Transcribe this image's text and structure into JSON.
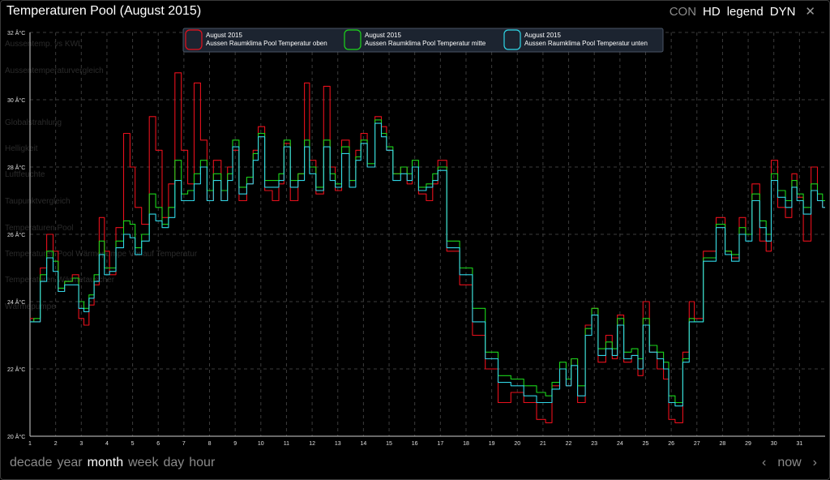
{
  "title": "Temperaturen Pool (August 2015)",
  "top_controls": {
    "con": "CON",
    "hd": "HD",
    "legend": "legend",
    "dyn": "DYN",
    "close": "✕"
  },
  "bottom_nav": {
    "decade": "decade",
    "year": "year",
    "month": "month",
    "week": "week",
    "day": "day",
    "hour": "hour",
    "prev": "‹",
    "now": "now",
    "next": "›"
  },
  "ghost_menu": [
    "Aussentemp. vs KWL",
    "Aussentemperaturvergleich",
    "Globalstrahlung",
    "Helligkeit",
    "Luftfeuchte",
    "Taupunktvergleich",
    "Temperaturen Pool",
    "Temperaturen Pool Wärmepumpe Vorlauf Temperatur",
    "Temperaturen Wärmetauscher",
    "Wärmepumpe"
  ],
  "colors": {
    "oben": "#e8101c",
    "mitte": "#1bd51b",
    "unten": "#2fd6e6",
    "grid": "#3c3c3c",
    "axis": "#cfcfcf"
  },
  "chart_data": {
    "type": "line",
    "ylim": [
      20,
      32
    ],
    "xlim": [
      1,
      32
    ],
    "y_ticks": [
      20,
      22,
      24,
      26,
      28,
      30,
      32
    ],
    "y_tick_labels": [
      "20 Â°C",
      "22 Â°C",
      "24 Â°C",
      "26 Â°C",
      "28 Â°C",
      "30 Â°C",
      "32 Â°C"
    ],
    "x_ticks": [
      1,
      2,
      3,
      4,
      5,
      6,
      7,
      8,
      9,
      10,
      11,
      12,
      13,
      14,
      15,
      16,
      17,
      18,
      19,
      20,
      21,
      22,
      23,
      24,
      25,
      26,
      27,
      28,
      29,
      30,
      31
    ],
    "x_tick_labels": [
      "1",
      "2",
      "3",
      "4",
      "5",
      "6",
      "7",
      "8",
      "9",
      "10",
      "11",
      "12",
      "13",
      "14",
      "15",
      "16",
      "17",
      "18",
      "19",
      "20",
      "21",
      "22",
      "23",
      "24",
      "25",
      "26",
      "27",
      "28",
      "29",
      "30",
      "31"
    ],
    "grid": true,
    "legend_position": "top-center",
    "series": [
      {
        "name": "Aussen Raumklima Pool Temperatur oben",
        "period": "August 2015",
        "color": "#e8101c",
        "x": [
          1.0,
          1.3,
          1.5,
          1.8,
          2.0,
          2.2,
          2.5,
          2.8,
          3.0,
          3.2,
          3.4,
          3.6,
          3.8,
          4.0,
          4.2,
          4.5,
          4.8,
          5.0,
          5.2,
          5.5,
          5.8,
          6.0,
          6.3,
          6.5,
          6.8,
          7.0,
          7.3,
          7.5,
          7.8,
          8.0,
          8.3,
          8.6,
          8.8,
          9.0,
          9.3,
          9.6,
          9.8,
          10.0,
          10.3,
          10.6,
          10.8,
          11.0,
          11.3,
          11.6,
          11.8,
          12.0,
          12.3,
          12.6,
          12.8,
          13.0,
          13.3,
          13.6,
          13.8,
          14.0,
          14.3,
          14.6,
          14.8,
          15.0,
          15.3,
          15.6,
          15.8,
          16.0,
          16.3,
          16.6,
          16.8,
          17.0,
          17.5,
          18.0,
          18.5,
          19.0,
          19.5,
          20.0,
          20.5,
          21.0,
          21.2,
          21.5,
          21.8,
          22.0,
          22.2,
          22.5,
          22.8,
          23.0,
          23.3,
          23.6,
          23.8,
          24.0,
          24.3,
          24.6,
          24.8,
          25.0,
          25.3,
          25.6,
          25.8,
          26.0,
          26.3,
          26.6,
          26.8,
          27.0,
          27.5,
          28.0,
          28.2,
          28.5,
          28.8,
          29.0,
          29.3,
          29.6,
          29.8,
          30.0,
          30.3,
          30.6,
          30.8,
          31.0,
          31.3,
          31.6,
          31.8,
          32.0
        ],
        "y": [
          23.5,
          23.4,
          25.0,
          26.0,
          25.5,
          24.3,
          24.6,
          24.8,
          23.5,
          23.3,
          23.9,
          24.5,
          26.5,
          25.5,
          24.8,
          26.2,
          29.0,
          28.0,
          26.8,
          26.3,
          29.5,
          28.5,
          26.5,
          27.5,
          30.8,
          28.5,
          27.5,
          30.5,
          28.8,
          27.0,
          28.2,
          27.0,
          28.0,
          28.5,
          27.0,
          27.5,
          28.5,
          29.2,
          27.3,
          27.0,
          27.5,
          28.7,
          27.0,
          27.8,
          30.5,
          28.2,
          27.2,
          30.4,
          28.0,
          27.3,
          28.8,
          27.6,
          28.5,
          29.0,
          28.0,
          29.5,
          29.2,
          28.5,
          27.8,
          28.0,
          27.5,
          28.0,
          27.2,
          27.0,
          27.5,
          28.2,
          25.5,
          24.5,
          23.0,
          22.0,
          21.0,
          21.3,
          21.0,
          20.5,
          20.4,
          21.5,
          22.0,
          21.5,
          22.3,
          21.0,
          23.3,
          23.8,
          22.2,
          23.0,
          22.3,
          23.6,
          22.2,
          22.4,
          21.8,
          24.0,
          22.5,
          22.0,
          21.7,
          20.5,
          20.4,
          22.5,
          24.0,
          23.5,
          25.5,
          26.5,
          25.5,
          25.3,
          26.5,
          26.0,
          27.5,
          25.8,
          25.5,
          28.2,
          26.8,
          26.5,
          27.8,
          27.1,
          25.8,
          28.0,
          27.0,
          26.8
        ]
      },
      {
        "name": "Aussen Raumklima Pool Temperatur mitte",
        "period": "August 2015",
        "color": "#1bd51b",
        "x": [
          1.0,
          1.3,
          1.5,
          1.8,
          2.0,
          2.2,
          2.5,
          2.8,
          3.0,
          3.2,
          3.4,
          3.6,
          3.8,
          4.0,
          4.2,
          4.5,
          4.8,
          5.0,
          5.2,
          5.5,
          5.8,
          6.0,
          6.3,
          6.5,
          6.8,
          7.0,
          7.3,
          7.5,
          7.8,
          8.0,
          8.3,
          8.6,
          8.8,
          9.0,
          9.3,
          9.6,
          9.8,
          10.0,
          10.3,
          10.6,
          10.8,
          11.0,
          11.3,
          11.6,
          11.8,
          12.0,
          12.3,
          12.6,
          12.8,
          13.0,
          13.3,
          13.6,
          13.8,
          14.0,
          14.3,
          14.6,
          14.8,
          15.0,
          15.3,
          15.6,
          15.8,
          16.0,
          16.3,
          16.6,
          16.8,
          17.0,
          17.5,
          18.0,
          18.5,
          19.0,
          19.5,
          20.0,
          20.5,
          21.0,
          21.2,
          21.5,
          21.8,
          22.0,
          22.2,
          22.5,
          22.8,
          23.0,
          23.3,
          23.6,
          23.8,
          24.0,
          24.3,
          24.6,
          24.8,
          25.0,
          25.3,
          25.6,
          25.8,
          26.0,
          26.3,
          26.6,
          26.8,
          27.0,
          27.5,
          28.0,
          28.2,
          28.5,
          28.8,
          29.0,
          29.3,
          29.6,
          29.8,
          30.0,
          30.3,
          30.6,
          30.8,
          31.0,
          31.3,
          31.6,
          31.8,
          32.0
        ],
        "y": [
          23.4,
          23.5,
          24.8,
          25.5,
          25.2,
          24.4,
          24.6,
          24.7,
          24.0,
          23.8,
          24.2,
          24.8,
          25.8,
          25.0,
          25.0,
          25.8,
          26.4,
          26.3,
          25.6,
          26.0,
          27.2,
          26.8,
          26.3,
          26.8,
          28.2,
          27.2,
          27.3,
          27.8,
          28.2,
          27.3,
          27.8,
          27.3,
          27.8,
          28.8,
          27.4,
          27.7,
          28.4,
          29.0,
          27.6,
          27.6,
          27.8,
          28.8,
          27.6,
          27.8,
          28.8,
          28.0,
          27.4,
          28.8,
          27.8,
          27.5,
          28.6,
          27.6,
          28.3,
          28.8,
          28.1,
          29.4,
          29.0,
          28.6,
          27.8,
          28.0,
          27.8,
          28.2,
          27.4,
          27.5,
          27.8,
          28.0,
          25.8,
          25.0,
          23.8,
          22.5,
          21.8,
          21.7,
          21.5,
          21.3,
          21.2,
          21.6,
          22.2,
          21.7,
          22.3,
          21.5,
          23.2,
          23.8,
          22.6,
          22.8,
          22.6,
          23.5,
          22.5,
          22.6,
          22.3,
          23.5,
          22.7,
          22.5,
          22.2,
          21.2,
          21.0,
          22.3,
          23.5,
          23.4,
          25.3,
          26.3,
          25.5,
          25.4,
          26.2,
          26.0,
          27.2,
          26.4,
          26.0,
          27.8,
          27.3,
          27.0,
          27.6,
          27.2,
          26.8,
          27.5,
          27.2,
          27.0
        ]
      },
      {
        "name": "Aussen Raumklima Pool Temperatur unten",
        "period": "August 2015",
        "color": "#2fd6e6",
        "x": [
          1.0,
          1.3,
          1.5,
          1.8,
          2.0,
          2.2,
          2.5,
          2.8,
          3.0,
          3.2,
          3.4,
          3.6,
          3.8,
          4.0,
          4.2,
          4.5,
          4.8,
          5.0,
          5.2,
          5.5,
          5.8,
          6.0,
          6.3,
          6.5,
          6.8,
          7.0,
          7.3,
          7.5,
          7.8,
          8.0,
          8.3,
          8.6,
          8.8,
          9.0,
          9.3,
          9.6,
          9.8,
          10.0,
          10.3,
          10.6,
          10.8,
          11.0,
          11.3,
          11.6,
          11.8,
          12.0,
          12.3,
          12.6,
          12.8,
          13.0,
          13.3,
          13.6,
          13.8,
          14.0,
          14.3,
          14.6,
          14.8,
          15.0,
          15.3,
          15.6,
          15.8,
          16.0,
          16.3,
          16.6,
          16.8,
          17.0,
          17.5,
          18.0,
          18.5,
          19.0,
          19.5,
          20.0,
          20.5,
          21.0,
          21.2,
          21.5,
          21.8,
          22.0,
          22.2,
          22.5,
          22.8,
          23.0,
          23.3,
          23.6,
          23.8,
          24.0,
          24.3,
          24.6,
          24.8,
          25.0,
          25.3,
          25.6,
          25.8,
          26.0,
          26.3,
          26.6,
          26.8,
          27.0,
          27.5,
          28.0,
          28.2,
          28.5,
          28.8,
          29.0,
          29.3,
          29.6,
          29.8,
          30.0,
          30.3,
          30.6,
          30.8,
          31.0,
          31.3,
          31.6,
          31.8,
          32.0
        ],
        "y": [
          23.4,
          23.4,
          24.6,
          25.3,
          24.9,
          24.3,
          24.5,
          24.5,
          23.8,
          23.7,
          24.1,
          24.6,
          25.4,
          24.8,
          24.9,
          25.6,
          26.0,
          25.9,
          25.4,
          25.8,
          26.6,
          26.4,
          26.2,
          26.5,
          27.6,
          27.0,
          27.0,
          27.5,
          28.0,
          27.0,
          27.6,
          27.0,
          27.6,
          28.6,
          27.2,
          27.5,
          28.2,
          28.9,
          27.4,
          27.4,
          27.6,
          28.6,
          27.4,
          27.6,
          28.6,
          27.8,
          27.3,
          28.6,
          27.6,
          27.4,
          28.4,
          27.4,
          28.2,
          28.7,
          28.0,
          29.3,
          28.9,
          28.5,
          27.6,
          27.8,
          27.6,
          28.0,
          27.3,
          27.4,
          27.6,
          27.9,
          25.6,
          24.8,
          23.4,
          22.3,
          21.6,
          21.5,
          21.2,
          21.0,
          21.0,
          21.4,
          22.0,
          21.5,
          22.1,
          21.2,
          23.0,
          23.6,
          22.4,
          22.6,
          22.4,
          23.3,
          22.3,
          22.4,
          22.0,
          23.3,
          22.5,
          22.3,
          22.0,
          21.0,
          20.9,
          22.2,
          23.4,
          23.4,
          25.2,
          26.2,
          25.4,
          25.2,
          26.0,
          25.8,
          27.0,
          26.2,
          25.8,
          27.6,
          27.1,
          26.8,
          27.4,
          27.0,
          26.6,
          27.3,
          27.0,
          26.8
        ]
      }
    ]
  }
}
